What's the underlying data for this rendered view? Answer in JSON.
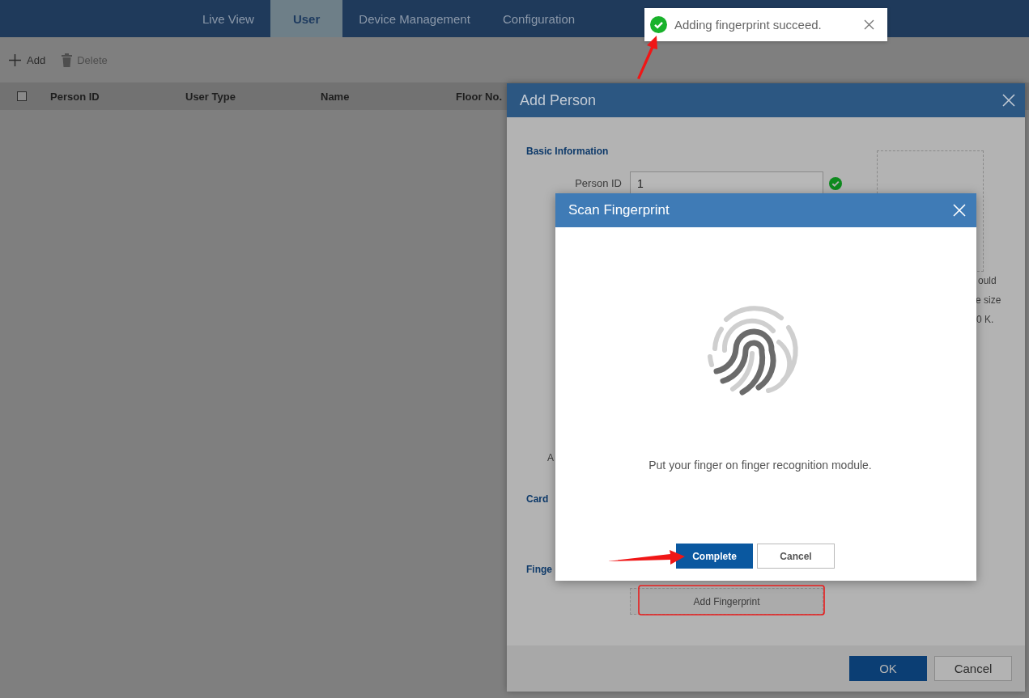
{
  "nav": {
    "tabs": [
      {
        "label": "Live View",
        "selected": false
      },
      {
        "label": "User",
        "selected": true
      },
      {
        "label": "Device Management",
        "selected": false
      },
      {
        "label": "Configuration",
        "selected": false
      }
    ]
  },
  "toolbar": {
    "buttons": [
      {
        "label": "Add",
        "disabled": false
      },
      {
        "label": "Delete",
        "disabled": true
      }
    ]
  },
  "table": {
    "select_all_checked": false,
    "columns": [
      "Person ID",
      "User Type",
      "Name",
      "Floor No."
    ]
  },
  "add_person_dialog": {
    "title": "Add Person",
    "section_basic": "Basic Information",
    "person_id_label": "Person ID",
    "person_id_value": "1",
    "person_id_valid": true,
    "photo_hint_fragments": [
      "ould",
      "e size",
      "0 K."
    ],
    "label_fragment": "A",
    "section_card": "Card",
    "section_fingerprint": "Finge",
    "add_fingerprint_button": "Add Fingerprint",
    "buttons": [
      {
        "label": "OK",
        "kind": "primary"
      },
      {
        "label": "Cancel",
        "kind": "secondary"
      }
    ]
  },
  "scan_dialog": {
    "title": "Scan Fingerprint",
    "message": "Put your finger on finger recognition module.",
    "buttons": [
      {
        "label": "Complete",
        "kind": "primary"
      },
      {
        "label": "Cancel",
        "kind": "secondary"
      }
    ]
  },
  "toast": {
    "kind": "success",
    "message": "Adding fingerprint succeed."
  },
  "annotations": [
    {
      "kind": "arrow"
    },
    {
      "kind": "arrow"
    },
    {
      "kind": "highlight"
    }
  ]
}
